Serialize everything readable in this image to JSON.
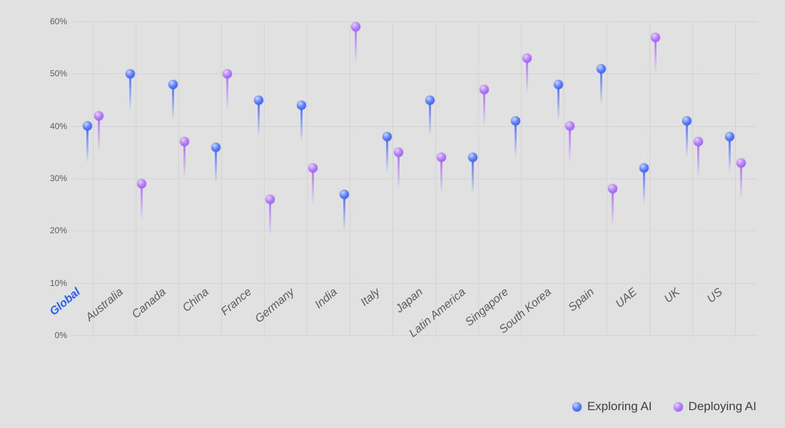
{
  "chart_data": {
    "type": "scatter",
    "title": "",
    "xlabel": "",
    "ylabel": "",
    "ylim": [
      0,
      60
    ],
    "y_ticks": [
      0,
      10,
      20,
      30,
      40,
      50,
      60
    ],
    "y_tick_labels": [
      "0%",
      "10%",
      "20%",
      "30%",
      "40%",
      "50%",
      "60%"
    ],
    "categories": [
      "Global",
      "Australia",
      "Canada",
      "China",
      "France",
      "Germany",
      "India",
      "Italy",
      "Japan",
      "Latin America",
      "Singapore",
      "South Korea",
      "Spain",
      "UAE",
      "UK",
      "US"
    ],
    "highlight_category": "Global",
    "series": [
      {
        "name": "Exploring AI",
        "color": "#3a5bff",
        "values": [
          40,
          50,
          48,
          36,
          45,
          44,
          27,
          38,
          45,
          34,
          41,
          48,
          51,
          32,
          41,
          38
        ]
      },
      {
        "name": "Deploying AI",
        "color": "#9a5bff",
        "values": [
          42,
          29,
          37,
          50,
          26,
          32,
          59,
          35,
          34,
          47,
          53,
          40,
          28,
          57,
          37,
          33
        ]
      }
    ],
    "legend_position": "bottom-right",
    "grid": true,
    "stem_length_pct": 7
  }
}
